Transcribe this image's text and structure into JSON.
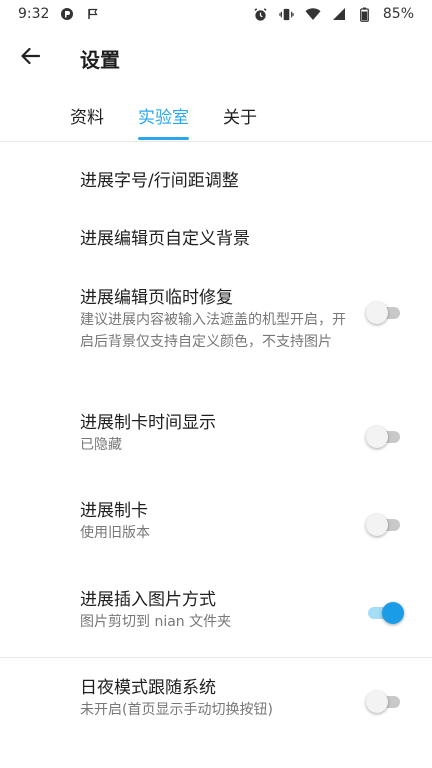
{
  "status_bar": {
    "time": "9:32",
    "battery": "85%",
    "icons_left": [
      "app-notification-icon",
      "flag-icon"
    ],
    "icons_right": [
      "alarm-icon",
      "vibrate-icon",
      "wifi-icon",
      "signal-icon",
      "battery-icon"
    ]
  },
  "app_bar": {
    "title": "设置"
  },
  "tabs": [
    {
      "label": "资料",
      "active": false
    },
    {
      "label": "实验室",
      "active": true
    },
    {
      "label": "关于",
      "active": false
    }
  ],
  "settings": [
    {
      "title": "进展字号/行间距调整"
    },
    {
      "title": "进展编辑页自定义背景"
    },
    {
      "title": "进展编辑页临时修复",
      "subtitle": "建议进展内容被输入法遮盖的机型开启，开启后背景仅支持自定义颜色，不支持图片",
      "switch": false
    },
    {
      "title": "进展制卡时间显示",
      "subtitle": "已隐藏",
      "switch": false
    },
    {
      "title": "进展制卡",
      "subtitle": "使用旧版本",
      "switch": false
    },
    {
      "title": "进展插入图片方式",
      "subtitle": "图片剪切到 nian 文件夹",
      "switch": true
    },
    {
      "title": "日夜模式跟随系统",
      "subtitle": "未开启(首页显示手动切换按钮)",
      "switch": false
    }
  ],
  "colors": {
    "accent": "#2aa7ea",
    "switch_on_thumb": "#1a9de6",
    "switch_on_track": "#a5dcf6",
    "switch_off_track": "#c9c9c9"
  }
}
